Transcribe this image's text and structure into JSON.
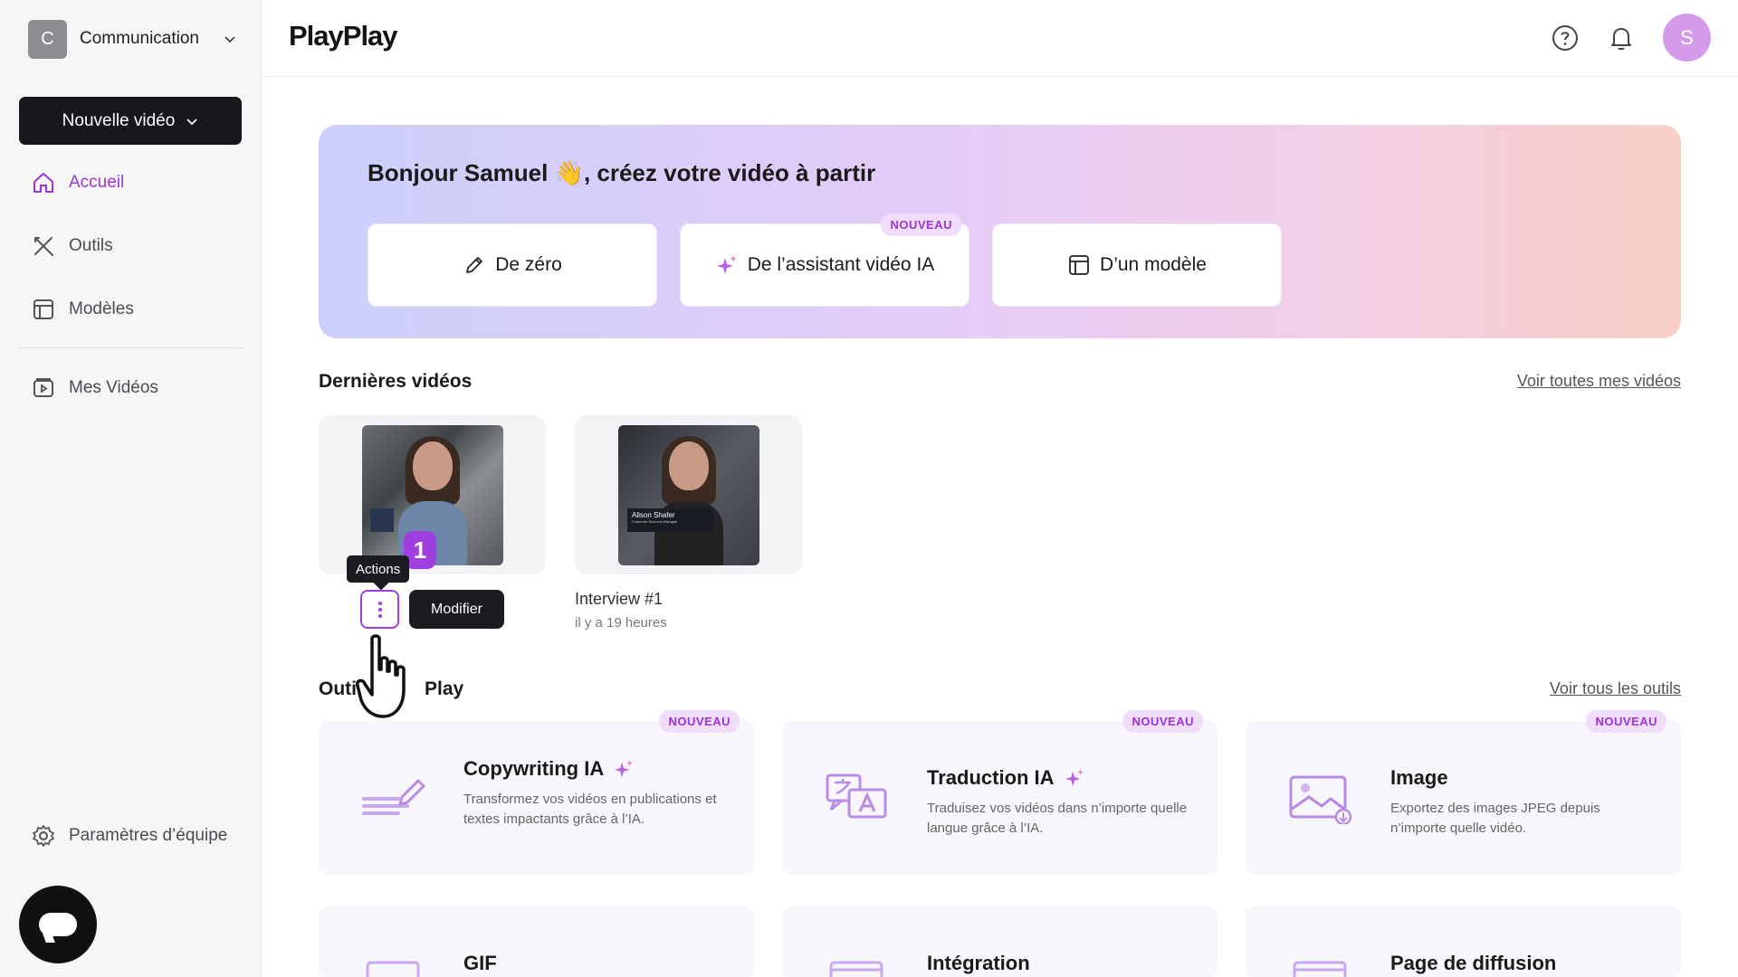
{
  "sidebar": {
    "workspace_initial": "C",
    "workspace_name": "Communication",
    "new_video_label": "Nouvelle vidéo",
    "nav": {
      "home": "Accueil",
      "tools": "Outils",
      "templates": "Modèles",
      "my_videos": "Mes Vidéos"
    },
    "team_settings": "Paramètres d’équipe"
  },
  "header": {
    "logo": "PlayPlay",
    "avatar_initial": "S"
  },
  "hero": {
    "title": "Bonjour Samuel 👋, créez votre vidéo à partir",
    "cards": {
      "scratch": "De zéro",
      "ai_assistant": "De l’assistant vidéo IA",
      "template": "D’un modèle"
    },
    "new_badge": "NOUVEAU"
  },
  "latest_videos": {
    "title": "Dernières vidéos",
    "see_all": "Voir toutes mes vidéos",
    "step_number": "1",
    "tooltip": "Actions",
    "edit_button": "Modifier",
    "videos": [
      {
        "title": "Interview #1",
        "meta": "il y a 19 heures",
        "lower_third_name": "Alison Shafer",
        "lower_third_role": "Customer Success Manager"
      }
    ]
  },
  "tools": {
    "title_left": "Outi",
    "title_right": "Play",
    "see_all": "Voir tous les outils",
    "new_badge": "NOUVEAU",
    "items": [
      {
        "name": "Copywriting IA",
        "desc": "Transformez vos vidéos en publications et textes impactants grâce à l’IA."
      },
      {
        "name": "Traduction IA",
        "desc": "Traduisez vos vidéos dans n’importe quelle langue grâce à l’IA."
      },
      {
        "name": "Image",
        "desc": "Exportez des images JPEG depuis n’importe quelle vidéo."
      },
      {
        "name": "GIF"
      },
      {
        "name": "Intégration"
      },
      {
        "name": "Page de diffusion"
      }
    ]
  },
  "colors": {
    "accent": "#9b35d6",
    "dark": "#17171c"
  }
}
